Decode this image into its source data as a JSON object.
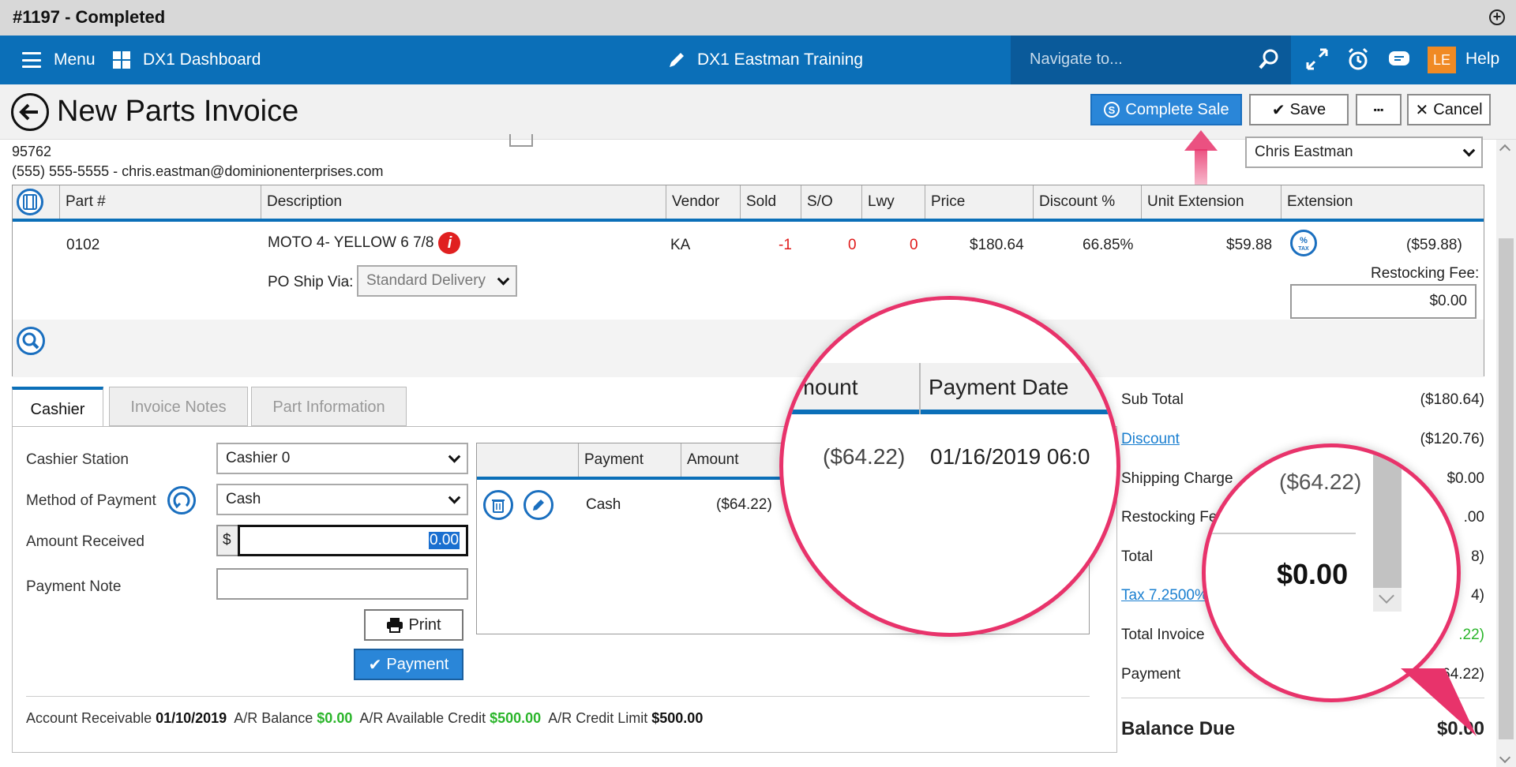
{
  "window": {
    "title": "#1197 - Completed"
  },
  "nav": {
    "menu_label": "Menu",
    "dashboard_label": "DX1 Dashboard",
    "store_label": "DX1 Eastman Training",
    "search_placeholder": "Navigate to...",
    "avatar_initials": "LE",
    "help_label": "Help"
  },
  "header": {
    "title": "New Parts Invoice",
    "complete_sale_label": "Complete Sale",
    "save_label": "Save",
    "more_label": "▪▪▪",
    "cancel_label": "Cancel"
  },
  "customer": {
    "zip": "95762",
    "contact": "(555) 555-5555 - chris.eastman@dominionenterprises.com",
    "salesperson": "Chris Eastman"
  },
  "parts_table": {
    "columns": [
      "Part #",
      "Description",
      "Vendor",
      "Sold",
      "S/O",
      "Lwy",
      "Price",
      "Discount %",
      "Unit Extension",
      "Extension"
    ],
    "row": {
      "part_no": "0102",
      "description": "MOTO 4- YELLOW 6 7/8",
      "vendor": "KA",
      "sold": "-1",
      "so": "0",
      "lwy": "0",
      "price": "$180.64",
      "discount": "66.85%",
      "unit_extension": "$59.88",
      "extension": "($59.88)"
    },
    "po_ship_via_label": "PO Ship Via:",
    "po_ship_via_value": "Standard Delivery",
    "restocking_label": "Restocking Fee:",
    "restocking_value": "$0.00"
  },
  "tabs": [
    "Cashier",
    "Invoice Notes",
    "Part Information"
  ],
  "cashier": {
    "station_label": "Cashier Station",
    "station_value": "Cashier 0",
    "method_label": "Method of Payment",
    "method_value": "Cash",
    "amount_label": "Amount Received",
    "amount_prefix": "$",
    "amount_value": "0.00",
    "note_label": "Payment Note",
    "print_label": "Print",
    "payment_label": "Payment"
  },
  "payments_table": {
    "columns": [
      "Payment",
      "Amount"
    ],
    "row": {
      "payment": "Cash",
      "amount": "($64.22)"
    }
  },
  "ar": {
    "ar_label": "Account Receivable",
    "ar_date": "01/10/2019",
    "balance_label": "A/R Balance",
    "balance_value": "$0.00",
    "credit_label": "A/R Available Credit",
    "credit_value": "$500.00",
    "limit_label": "A/R Credit Limit",
    "limit_value": "$500.00"
  },
  "totals": {
    "sub_total_label": "Sub Total",
    "sub_total_value": "($180.64)",
    "discount_label": "Discount",
    "discount_value": "($120.76)",
    "shipping_label": "Shipping Charge",
    "shipping_value": "$0.00",
    "restocking_label": "Restocking Fe",
    "restocking_value": ".00",
    "total_label": "Total",
    "total_value": "8)",
    "tax_label": "Tax 7.2500%",
    "tax_value": "4)",
    "total_invoice_label": "Total Invoice",
    "total_invoice_value": ".22)",
    "payment_label": "Payment",
    "payment_value": "64.22)",
    "balance_due_label": "Balance Due",
    "balance_due_value": "$0.00"
  },
  "zoom1": {
    "col_amount": "Amount",
    "col_date": "Payment Date",
    "amount": "($64.22)",
    "date": "01/16/2019 06:0"
  },
  "zoom2": {
    "amount": "($64.22)",
    "balance": "$0.00"
  },
  "colors": {
    "brand_blue": "#0b6fb8",
    "accent_pink": "#e8336b",
    "green": "#2bb52b",
    "red": "#e01b1b"
  }
}
